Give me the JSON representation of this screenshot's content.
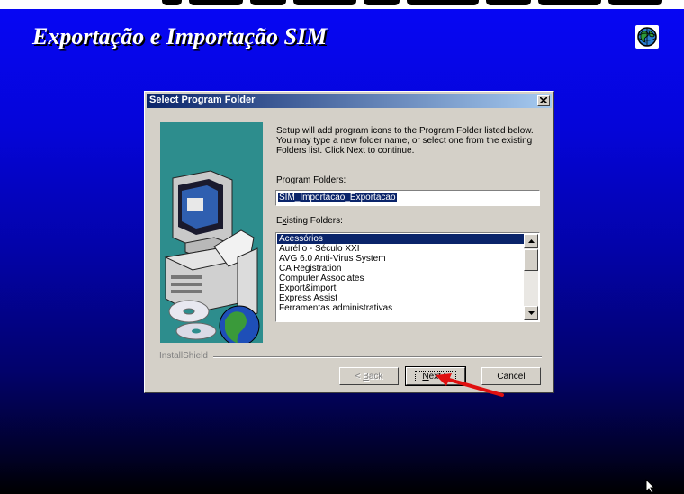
{
  "app": {
    "title": "Exportação e Importação SIM"
  },
  "dialog": {
    "title": "Select Program Folder",
    "intro": "Setup will add program icons to the Program Folder listed below. You may type a new folder name, or select one from the existing Folders list.  Click Next to continue.",
    "program_folders_label_key": "P",
    "program_folders_label_rest": "rogram Folders:",
    "program_folder_value": "SIM_Importacao_Exportacao",
    "existing_folders_label_pre": "E",
    "existing_folders_label_key": "x",
    "existing_folders_label_rest": "isting Folders:",
    "existing_folders": [
      "Acessórios",
      "Aurélio - Século XXI",
      "AVG 6.0 Anti-Virus System",
      "CA Registration",
      "Computer Associates",
      "Export&import",
      "Express Assist",
      "Ferramentas administrativas"
    ],
    "selected_folder_index": 0,
    "installshield_label": "InstallShield",
    "buttons": {
      "back_pre": "< ",
      "back_key": "B",
      "back_rest": "ack",
      "next_key": "N",
      "next_rest": "ext >",
      "cancel": "Cancel"
    }
  },
  "colors": {
    "background_top": "#0606f4",
    "background_bottom": "#000000",
    "titlebar_start": "#0a246a",
    "titlebar_end": "#a6caf0",
    "dialog_face": "#d4d0c8",
    "picture_panel": "#2d8d8d",
    "annotation_arrow": "#e01010"
  },
  "icons": [
    "globe-icon",
    "close-icon",
    "computer-illustration",
    "cd-discs-illustration",
    "annotation-arrow",
    "mouse-pointer-icon"
  ]
}
